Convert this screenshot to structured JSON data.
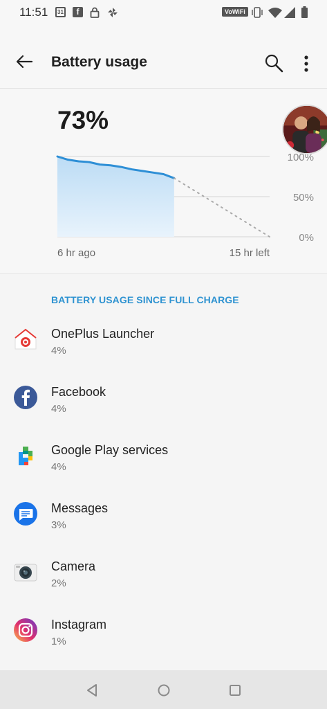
{
  "status_bar": {
    "time": "11:51",
    "calendar_day": "31",
    "facebook_glyph": "f",
    "wifi_badge": "VoWiFi",
    "icons": [
      "calendar-icon",
      "facebook-icon",
      "lock-icon",
      "pinwheel-icon",
      "vowifi-icon",
      "vibrate-icon",
      "wifi-icon",
      "signal-icon",
      "battery-icon"
    ]
  },
  "app_bar": {
    "title": "Battery usage",
    "icons": [
      "back-arrow-icon",
      "search-icon",
      "more-vert-icon"
    ]
  },
  "summary": {
    "percent": "73%",
    "time_start": "6 hr ago",
    "time_end": "15 hr left"
  },
  "chart_data": {
    "type": "line",
    "y_ticks": [
      "100%",
      "50%",
      "0%"
    ],
    "ylim": [
      0,
      100
    ],
    "series": [
      {
        "style": "solid-with-area",
        "color": "#2e8fd6",
        "x": [
          0,
          0.05,
          0.1,
          0.15,
          0.2,
          0.25,
          0.3,
          0.35,
          0.4,
          0.45,
          0.5,
          0.55
        ],
        "y": [
          100,
          96,
          94,
          93,
          90,
          89,
          87,
          84,
          82,
          80,
          78,
          73
        ]
      },
      {
        "style": "dotted-projection",
        "color": "#aaaaaa",
        "x": [
          0.55,
          1.0
        ],
        "y": [
          73,
          0
        ]
      }
    ]
  },
  "section": {
    "title": "BATTERY USAGE SINCE FULL CHARGE"
  },
  "apps": [
    {
      "name": "OnePlus Launcher",
      "percent": "4%",
      "icon": "oneplus-launcher-icon"
    },
    {
      "name": "Facebook",
      "percent": "4%",
      "icon": "facebook-icon"
    },
    {
      "name": "Google Play services",
      "percent": "4%",
      "icon": "google-play-services-icon"
    },
    {
      "name": "Messages",
      "percent": "3%",
      "icon": "messages-icon"
    },
    {
      "name": "Camera",
      "percent": "2%",
      "icon": "camera-icon"
    },
    {
      "name": "Instagram",
      "percent": "1%",
      "icon": "instagram-icon"
    }
  ],
  "colors": {
    "accent": "#2f93d1",
    "chart_line": "#2e8fd6",
    "background": "#f5f5f5"
  },
  "nav_bar": {
    "icons": [
      "nav-back-icon",
      "nav-home-icon",
      "nav-recents-icon"
    ]
  }
}
